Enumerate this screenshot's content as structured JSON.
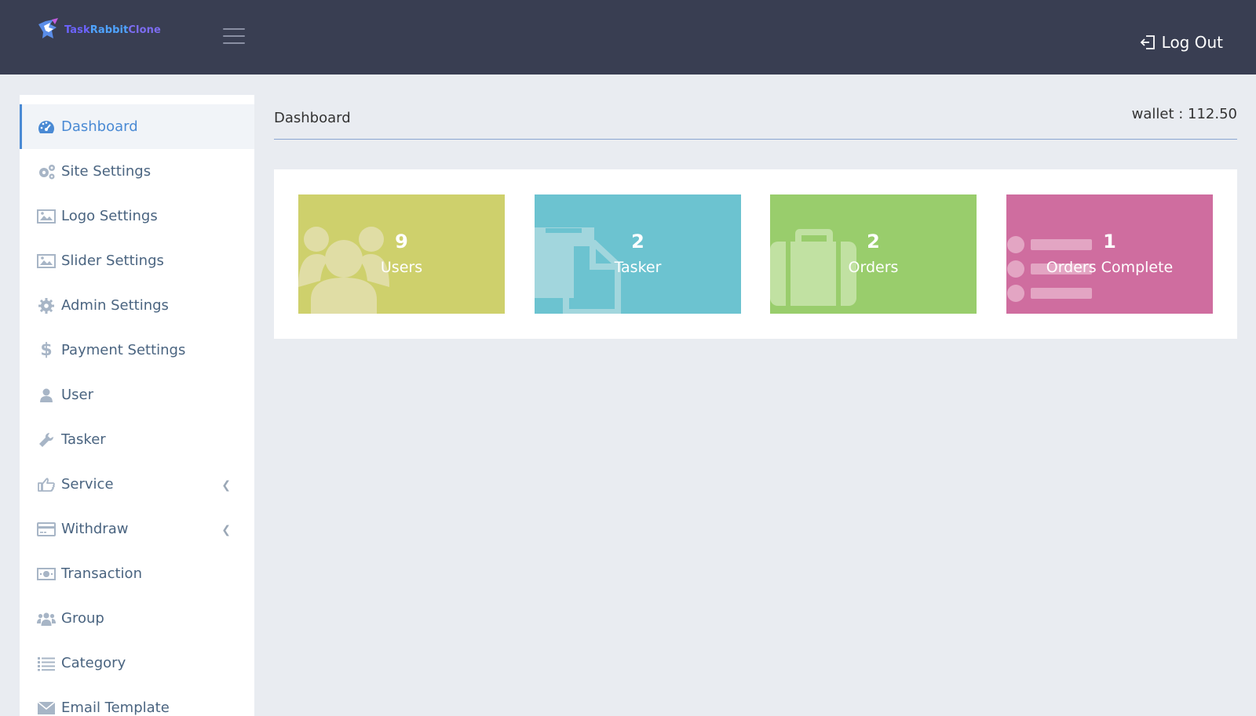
{
  "header": {
    "brand": {
      "part1": "Task",
      "part2": "Rabbit",
      "part3": "Clone"
    },
    "logout_label": "Log Out"
  },
  "sidebar": {
    "items": [
      {
        "label": "Dashboard",
        "icon": "dashboard-icon",
        "active": true
      },
      {
        "label": "Site Settings",
        "icon": "gears-icon"
      },
      {
        "label": "Logo Settings",
        "icon": "image-icon"
      },
      {
        "label": "Slider Settings",
        "icon": "image-icon"
      },
      {
        "label": "Admin Settings",
        "icon": "gear-icon"
      },
      {
        "label": "Payment Settings",
        "icon": "dollar-icon"
      },
      {
        "label": "User",
        "icon": "user-icon"
      },
      {
        "label": "Tasker",
        "icon": "wrench-icon"
      },
      {
        "label": "Service",
        "icon": "hand-point-icon",
        "has_submenu": true
      },
      {
        "label": "Withdraw",
        "icon": "credit-card-icon",
        "has_submenu": true
      },
      {
        "label": "Transaction",
        "icon": "money-icon"
      },
      {
        "label": "Group",
        "icon": "users-icon"
      },
      {
        "label": "Category",
        "icon": "list-icon"
      },
      {
        "label": "Email Template",
        "icon": "envelope-icon"
      }
    ]
  },
  "main": {
    "title": "Dashboard",
    "wallet": "wallet : 112.50",
    "cards": [
      {
        "count": "9",
        "label": "Users",
        "color": "#ced06c",
        "icon": "users-icon"
      },
      {
        "count": "2",
        "label": "Tasker",
        "color": "#6cc3d0",
        "icon": "file-icon"
      },
      {
        "count": "2",
        "label": "Orders",
        "color": "#99cd6c",
        "icon": "briefcase-icon"
      },
      {
        "count": "1",
        "label": "Orders Complete",
        "color": "#cf6d9f",
        "icon": "list-icon"
      }
    ]
  }
}
